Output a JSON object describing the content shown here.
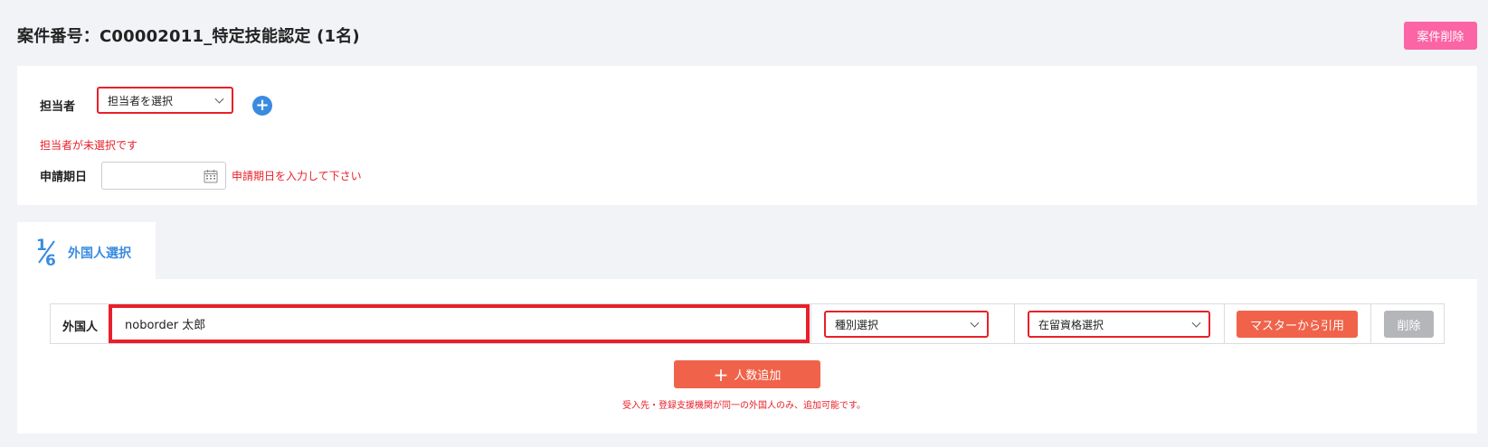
{
  "header": {
    "title": "案件番号：C00002011_特定技能認定 (1名)",
    "delete_case_label": "案件削除"
  },
  "assignee": {
    "label": "担当者",
    "select_value": "担当者を選択",
    "error": "担当者が未選択です",
    "add_icon": "plus-circle-icon"
  },
  "application_date": {
    "label": "申請期日",
    "value": "",
    "error": "申請期日を入力して下さい",
    "icon": "calendar-icon"
  },
  "step_tab": {
    "step": "1/6",
    "label": "外国人選択"
  },
  "foreigner_row": {
    "label": "外国人",
    "name_value": "noborder 太郎",
    "type_select": "種別選択",
    "status_select": "在留資格選択",
    "master_button": "マスターから引用",
    "delete_button": "削除"
  },
  "add_people": {
    "label": "人数追加",
    "icon": "plus-icon"
  },
  "note": "受入先・登録支援機関が同一の外国人のみ、追加可能です。",
  "colors": {
    "accent_blue": "#3a8be0",
    "error_red": "#e8202a",
    "orange": "#f0634a",
    "pink": "#fb64a5",
    "gray_button": "#b4b6ba"
  }
}
